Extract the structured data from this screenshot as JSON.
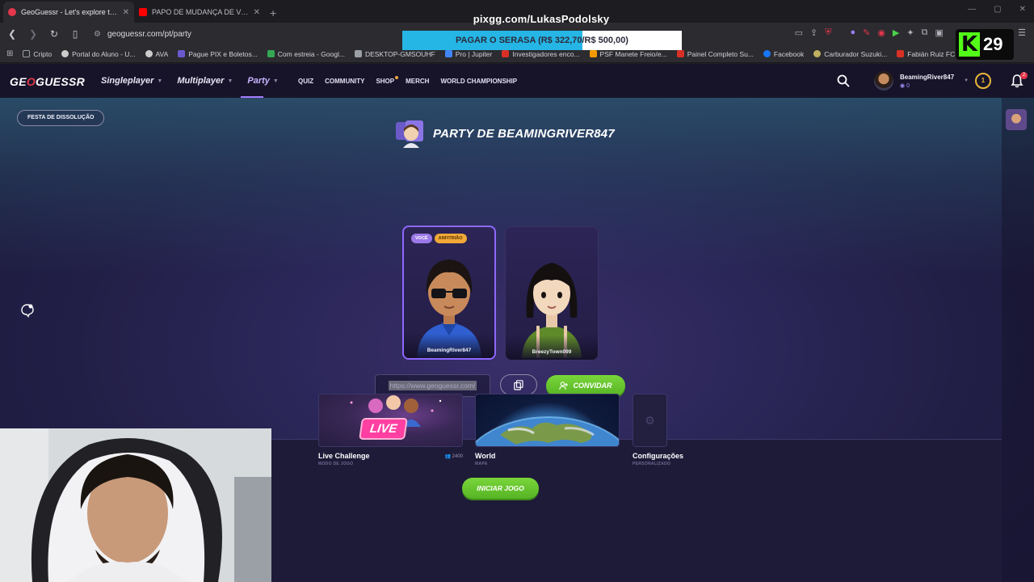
{
  "browser": {
    "tabs": [
      {
        "title": "GeoGuessr - Let's explore the wo",
        "favicon_color": "#e5374b",
        "active": true
      },
      {
        "title": "PAPO DE MUDANÇA DE VIDA COM",
        "favicon_color": "#ff0000",
        "active": false
      }
    ],
    "url": "geoguessr.com/pt/party",
    "bookmarks": [
      {
        "label": "Cripto",
        "color": "#9aa0a6"
      },
      {
        "label": "Portal do Aluno - U...",
        "color": "#cccccc"
      },
      {
        "label": "AVA",
        "color": "#cccccc"
      },
      {
        "label": "Pague PIX e Boletos...",
        "color": "#6a5acd"
      },
      {
        "label": "Com estreia - Googl...",
        "color": "#34a853"
      },
      {
        "label": "DESKTOP-GMSOUHF",
        "color": "#9aa0a6"
      },
      {
        "label": "Pro | Jupiter",
        "color": "#4285f4"
      },
      {
        "label": "Investigadores enco...",
        "color": "#d93025"
      },
      {
        "label": "PSF Manete Freio/e...",
        "color": "#f29900"
      },
      {
        "label": "Painel Completo Su...",
        "color": "#d93025"
      },
      {
        "label": "Facebook",
        "color": "#1877f2"
      },
      {
        "label": "Carburador Suzuki...",
        "color": "#c0b060"
      },
      {
        "label": "Fabián Ruiz FC Pro L...",
        "color": "#d93025"
      }
    ]
  },
  "overlay": {
    "pix_url": "pixgg.com/LukasPodolsky",
    "goal_text": "PAGAR O SERASA (R$ 322,70/R$ 500,00)",
    "goal_progress": 0.6454,
    "kick_logo": "K",
    "viewer_count": "29"
  },
  "nav": {
    "logo": "GEOGUESSR",
    "main_items": [
      {
        "label": "Singleplayer",
        "active": false
      },
      {
        "label": "Multiplayer",
        "active": false
      },
      {
        "label": "Party",
        "active": true
      }
    ],
    "sub_items": [
      "QUIZ",
      "COMMUNITY",
      "SHOP",
      "MERCH",
      "WORLD CHAMPIONSHIP"
    ],
    "username": "BeamingRiver847",
    "coins": "0",
    "level": "1",
    "notifications": "2"
  },
  "party": {
    "disband_label": "FESTA DE DISSOLUÇÃO",
    "title": "PARTY DE BEAMINGRIVER847",
    "players": [
      {
        "name": "BeamingRiver847",
        "tags": [
          "VOCÊ",
          "ANFITRIÃO"
        ]
      },
      {
        "name": "BreezyTown099",
        "tags": []
      }
    ],
    "invite_url": "https://www.geoguessr.com/",
    "invite_label": "CONVIDAR"
  },
  "game_options": {
    "live": {
      "badge": "LIVE",
      "name": "Live Challenge",
      "sub": "MODO DE JOGO",
      "count": "2400"
    },
    "world": {
      "name": "World",
      "sub": "MAPA"
    },
    "settings": {
      "name": "Configurações",
      "sub": "PERSONALIZADO"
    },
    "start_label": "INICIAR JOGO"
  },
  "colors": {
    "accent_green": "#56b425",
    "accent_purple": "#8e68ff",
    "brand_red": "#e5374b",
    "live_pink": "#ff3fa1",
    "kick_green": "#53fc18"
  }
}
